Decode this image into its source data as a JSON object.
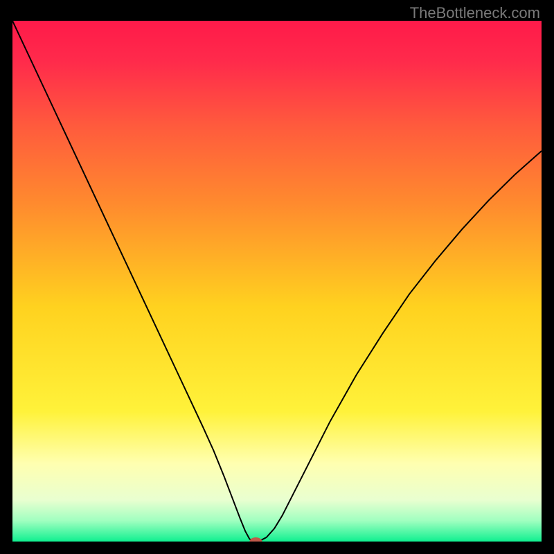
{
  "watermark": "TheBottleneck.com",
  "chart_data": {
    "type": "line",
    "title": "",
    "xlabel": "",
    "ylabel": "",
    "xlim": [
      0,
      100
    ],
    "ylim": [
      0,
      100
    ],
    "background_gradient": {
      "stops": [
        {
          "offset": 0.0,
          "color": "#ff1a4a"
        },
        {
          "offset": 0.08,
          "color": "#ff2b4b"
        },
        {
          "offset": 0.2,
          "color": "#ff5a3d"
        },
        {
          "offset": 0.35,
          "color": "#ff8a2e"
        },
        {
          "offset": 0.55,
          "color": "#ffd21f"
        },
        {
          "offset": 0.75,
          "color": "#fff23a"
        },
        {
          "offset": 0.85,
          "color": "#ffffb0"
        },
        {
          "offset": 0.92,
          "color": "#e9ffd0"
        },
        {
          "offset": 0.96,
          "color": "#a0ffc0"
        },
        {
          "offset": 1.0,
          "color": "#10f090"
        }
      ]
    },
    "series": [
      {
        "name": "bottleneck-curve",
        "color": "#000000",
        "x": [
          0,
          3,
          6,
          9,
          12,
          15,
          18,
          21,
          24,
          27,
          30,
          33,
          36,
          38,
          40,
          41.5,
          43,
          44,
          44.8,
          45.5,
          46.5,
          48,
          49.5,
          51,
          53,
          56,
          60,
          65,
          70,
          75,
          80,
          85,
          90,
          95,
          100
        ],
        "y": [
          100,
          93.5,
          87,
          80.5,
          74,
          67.5,
          61,
          54.5,
          48,
          41.5,
          35,
          28.5,
          22,
          17.5,
          12.5,
          8.5,
          4.5,
          2,
          0.5,
          0,
          0,
          0.8,
          2.5,
          5,
          9,
          15,
          23,
          32,
          40,
          47.5,
          54,
          60,
          65.5,
          70.5,
          75
        ]
      }
    ],
    "marker": {
      "name": "sweet-spot-marker",
      "x": 46,
      "y": 0,
      "color": "#c05a4a",
      "rx": 9,
      "ry": 6
    }
  }
}
